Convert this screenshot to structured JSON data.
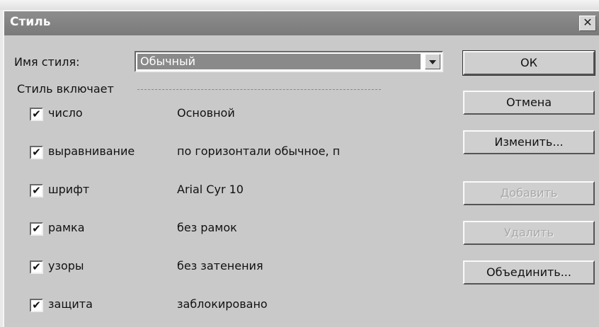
{
  "window": {
    "title": "Стиль",
    "close_glyph": "✕"
  },
  "style_name": {
    "label": "Имя стиля:",
    "value": "Обычный"
  },
  "group": {
    "label": "Стиль включает"
  },
  "options": [
    {
      "label": "число",
      "value": "Основной",
      "checked": true
    },
    {
      "label": "выравнивание",
      "value": "по горизонтали обычное, п",
      "checked": true
    },
    {
      "label": "шрифт",
      "value": "Arial Cyr 10",
      "checked": true
    },
    {
      "label": "рамка",
      "value": "без рамок",
      "checked": true
    },
    {
      "label": "узоры",
      "value": "без затенения",
      "checked": true
    },
    {
      "label": "защита",
      "value": "заблокировано",
      "checked": true
    }
  ],
  "buttons": {
    "ok": "ОК",
    "cancel": "Отмена",
    "modify": "Изменить...",
    "add": "Добавить",
    "delete": "Удалить",
    "merge": "Объединить..."
  },
  "check_glyph": "✔"
}
